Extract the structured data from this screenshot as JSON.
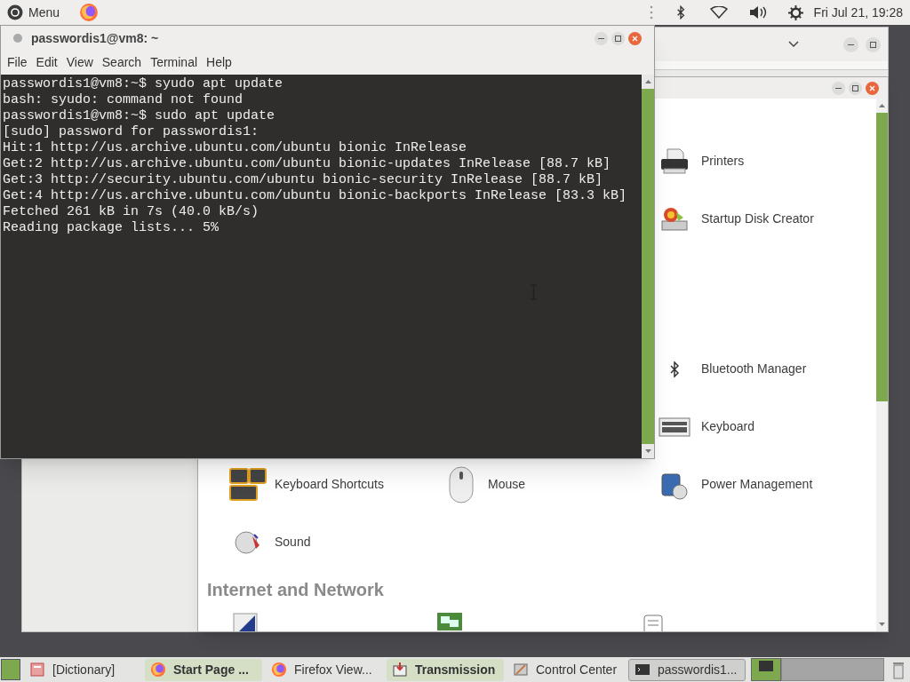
{
  "top_panel": {
    "menu_label": "Menu",
    "clock": "Fri Jul 21, 19:28"
  },
  "terminal": {
    "title": "passwordis1@vm8: ~",
    "menu": [
      "File",
      "Edit",
      "View",
      "Search",
      "Terminal",
      "Help"
    ],
    "lines": [
      "passwordis1@vm8:~$ syudo apt update",
      "bash: syudo: command not found",
      "passwordis1@vm8:~$ sudo apt update",
      "[sudo] password for passwordis1:",
      "Hit:1 http://us.archive.ubuntu.com/ubuntu bionic InRelease",
      "Get:2 http://us.archive.ubuntu.com/ubuntu bionic-updates InRelease [88.7 kB]",
      "Get:3 http://security.ubuntu.com/ubuntu bionic-security InRelease [88.7 kB]",
      "Get:4 http://us.archive.ubuntu.com/ubuntu bionic-backports InRelease [83.3 kB]",
      "Fetched 261 kB in 7s (40.0 kB/s)",
      "Reading package lists... 5%"
    ]
  },
  "control_center": {
    "items": [
      {
        "label": "Printers"
      },
      {
        "label": "Startup Disk Creator"
      },
      {
        "label": "Bluetooth Manager"
      },
      {
        "label": "Keyboard"
      },
      {
        "label": "Keyboard Shortcuts"
      },
      {
        "label": "Mouse"
      },
      {
        "label": "Power Management"
      },
      {
        "label": "Sound"
      }
    ],
    "section_heading": "Internet and Network"
  },
  "taskbar": {
    "items": [
      {
        "label": "[Dictionary]",
        "kind": "normal"
      },
      {
        "label": "Start Page ...",
        "kind": "attention"
      },
      {
        "label": "Firefox View...",
        "kind": "normal"
      },
      {
        "label": "Transmission",
        "kind": "attention"
      },
      {
        "label": "Control Center",
        "kind": "normal"
      },
      {
        "label": "passwordis1...",
        "kind": "active"
      }
    ]
  }
}
